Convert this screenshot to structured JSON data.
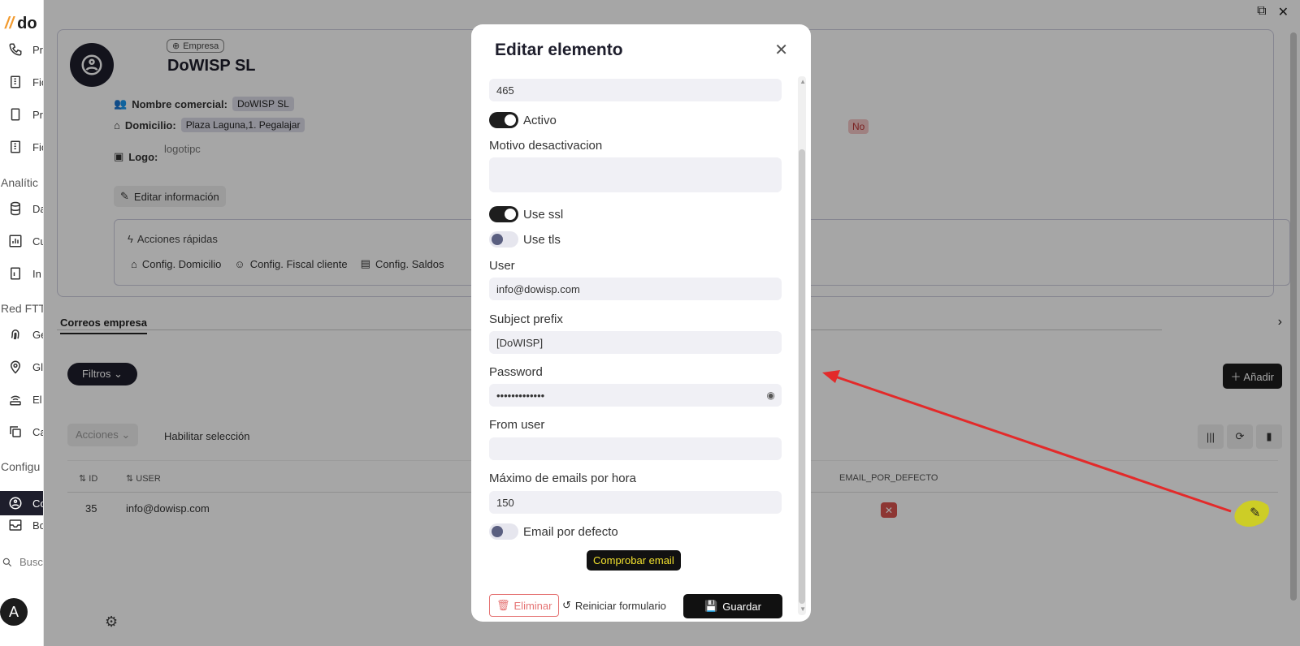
{
  "sidebar": {
    "logo_text": "do",
    "items": [
      {
        "label": "Pr",
        "icon": "phone-icon"
      },
      {
        "label": "Fic",
        "icon": "file-icon"
      },
      {
        "label": "Pr",
        "icon": "tablet-icon"
      },
      {
        "label": "Fic",
        "icon": "file-icon"
      }
    ],
    "section_analytics": "Analític",
    "items2": [
      {
        "label": "Da",
        "icon": "database-icon"
      },
      {
        "label": "Cu",
        "icon": "chart-icon"
      },
      {
        "label": "In",
        "icon": "report-icon"
      }
    ],
    "section_network": "Red FTT",
    "items3": [
      {
        "label": "Ge",
        "icon": "fingerprint-icon"
      },
      {
        "label": "Gl",
        "icon": "map-pin-icon"
      },
      {
        "label": "El",
        "icon": "router-icon"
      },
      {
        "label": "Ca",
        "icon": "copy-icon"
      }
    ],
    "section_config": "Configu",
    "active_item": "Co",
    "item_bo": "Bo",
    "search_placeholder": "Busca",
    "avatar_letter": "A"
  },
  "company": {
    "tag": "Empresa",
    "name": "DoWISP SL",
    "commercial_label": "Nombre comercial:",
    "commercial_value": "DoWISP SL",
    "address_label": "Domicilio:",
    "address_value": "Plaza Laguna,1. Pegalajar",
    "logo_label": "Logo:",
    "logo_alt": "logotipc",
    "no_chip": "No",
    "edit_label": "Editar información"
  },
  "quick_actions": {
    "title": "Acciones rápidas",
    "items": [
      "Config. Domicilio",
      "Config. Fiscal cliente",
      "Config. Saldos"
    ]
  },
  "tabs": {
    "active": "Correos empresa"
  },
  "toolbar": {
    "filters": "Filtros",
    "add": "Añadir",
    "actions": "Acciones",
    "enable_selection": "Habilitar selección"
  },
  "table": {
    "headers": {
      "id": "ID",
      "user": "USER",
      "email_default": "EMAIL_POR_DEFECTO"
    },
    "rows": [
      {
        "id": "35",
        "user": "info@dowisp.com"
      }
    ]
  },
  "modal": {
    "title": "Editar elemento",
    "top_value": "465",
    "activo_label": "Activo",
    "motivo_label": "Motivo desactivacion",
    "motivo_value": "",
    "use_ssl_label": "Use ssl",
    "use_tls_label": "Use tls",
    "user_label": "User",
    "user_value": "info@dowisp.com",
    "subject_label": "Subject prefix",
    "subject_value": "[DoWISP]",
    "password_label": "Password",
    "password_value": "•••••••••••••",
    "from_label": "From user",
    "from_value": "",
    "max_label": "Máximo de emails por hora",
    "max_value": "150",
    "default_email_label": "Email por defecto",
    "tooltip": "Comprobar email",
    "delete_label": "Eliminar",
    "reset_label": "Reiniciar formulario",
    "save_label": "Guardar"
  },
  "colors": {
    "accent_dark": "#1e1e2c",
    "annotation_red": "#e32a2a",
    "highlight_yellow": "#d4d40f",
    "danger": "#e57373"
  }
}
